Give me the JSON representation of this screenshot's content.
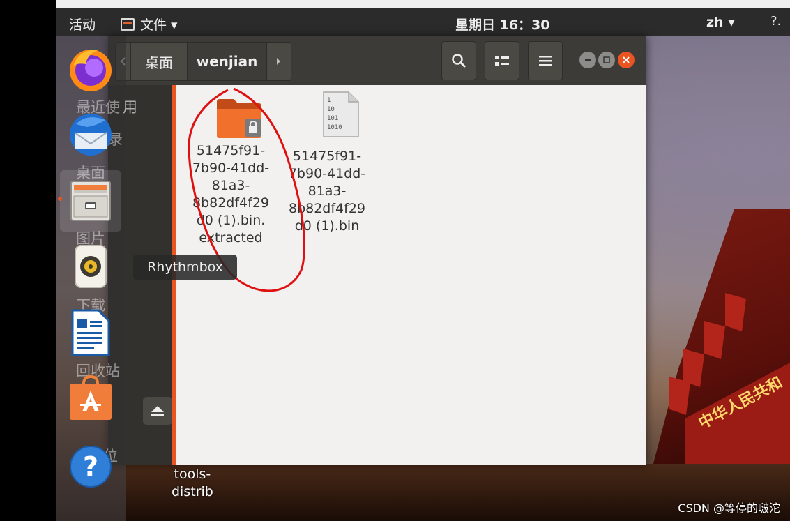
{
  "topbar": {
    "activities": "活动",
    "app_menu": "文件 ▾",
    "clock": "星期日 16：30",
    "language": "zh ▾",
    "status": "?."
  },
  "dock": {
    "items": [
      {
        "icon": "firefox-icon",
        "ghost_label": "最近使用"
      },
      {
        "icon": "thunderbird-icon",
        "ghost_label": "录"
      },
      {
        "icon": "files-icon",
        "ghost_label": "桌面"
      },
      {
        "icon": "rhythmbox-icon",
        "ghost_label": "图片"
      },
      {
        "icon": "libreoffice-writer-icon",
        "ghost_label": "下载"
      },
      {
        "icon": "software-center-icon",
        "ghost_label": "回收站"
      },
      {
        "icon": "help-icon",
        "ghost_label": "他位置"
      }
    ],
    "ghost_extra": "用",
    "tooltip": "Rhythmbox"
  },
  "file_manager": {
    "path": [
      "桌面",
      "wenjian"
    ],
    "files": [
      {
        "name_lines": [
          "51475f91-",
          "7b90-41dd-",
          "81a3-",
          "8b82df4f29",
          "d0 (1).bin.",
          "extracted"
        ],
        "type": "locked-folder"
      },
      {
        "name_lines": [
          "51475f91-",
          "7b90-41dd-",
          "81a3-",
          "8b82df4f29",
          "d0 (1).bin"
        ],
        "type": "binary"
      }
    ],
    "binary_glyph": [
      "1",
      "10",
      "101",
      "1010"
    ]
  },
  "desktop": {
    "icon_label": [
      "tools-",
      "distrib"
    ],
    "banner_text": "中华人民共和",
    "watermark": "CSDN @等停的啵沱"
  },
  "colors": {
    "accent": "#e95420",
    "annotation": "#e01010"
  }
}
